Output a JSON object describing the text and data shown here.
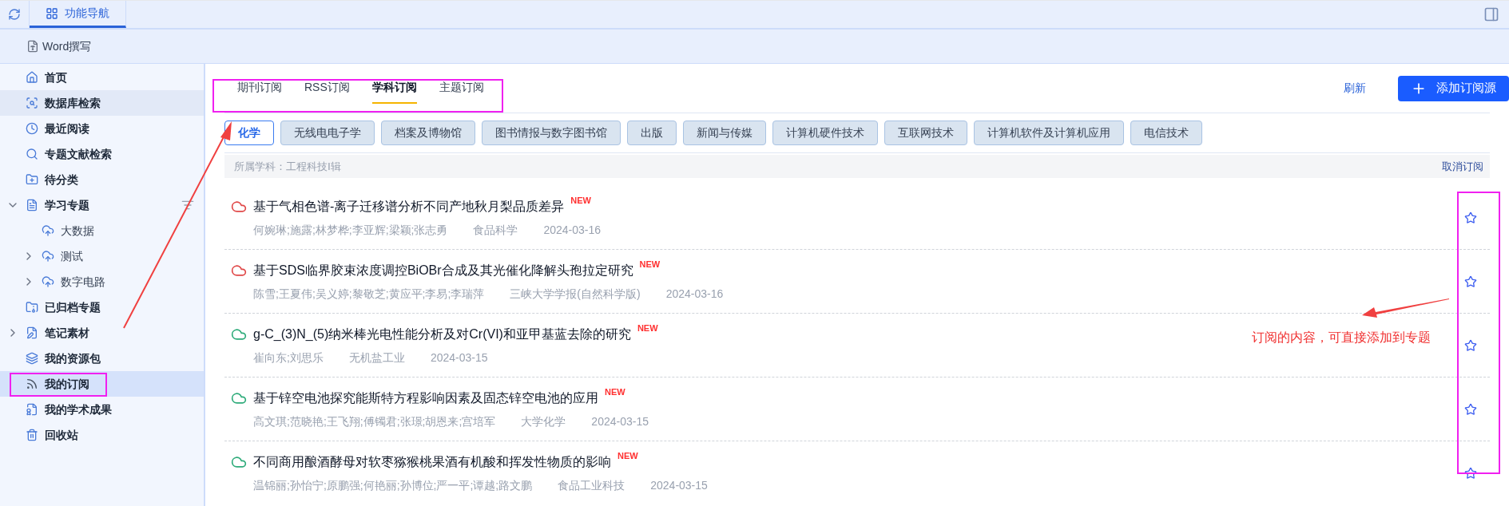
{
  "top_bar": {
    "tabs": [
      {
        "label": "功能导航",
        "selected": true
      }
    ]
  },
  "toolbar": {
    "button": "Word撰写"
  },
  "sidebar": {
    "items": [
      {
        "label": "首页",
        "selected": false,
        "hovered": false
      },
      {
        "label": "数据库检索",
        "selected": false,
        "hovered": true
      },
      {
        "label": "最近阅读",
        "selected": false,
        "hovered": false
      },
      {
        "label": "专题文献检索",
        "selected": false,
        "hovered": false
      },
      {
        "label": "待分类",
        "selected": false,
        "hovered": false
      },
      {
        "label": "学习专题",
        "selected": false,
        "hovered": false,
        "expanded": true,
        "children": [
          {
            "label": "大数据",
            "selected": false,
            "hovered": false
          },
          {
            "label": "测试",
            "selected": false,
            "hovered": false,
            "expanded": false
          },
          {
            "label": "数字电路",
            "selected": false,
            "hovered": false,
            "expanded": false
          }
        ]
      },
      {
        "label": "已归档专题",
        "selected": false,
        "hovered": false
      },
      {
        "label": "笔记素材",
        "selected": false,
        "hovered": false,
        "expanded": false
      },
      {
        "label": "我的资源包",
        "selected": false,
        "hovered": false
      },
      {
        "label": "我的订阅",
        "selected": true,
        "hovered": false
      },
      {
        "label": "我的学术成果",
        "selected": false,
        "hovered": false
      },
      {
        "label": "回收站",
        "selected": false,
        "hovered": false
      }
    ]
  },
  "tabs": [
    {
      "label": "期刊订阅",
      "selected": false
    },
    {
      "label": "RSS订阅",
      "selected": false
    },
    {
      "label": "学科订阅",
      "selected": true
    },
    {
      "label": "主题订阅",
      "selected": false
    }
  ],
  "actions": {
    "refresh": "刷新",
    "add": "添加订阅源"
  },
  "subjects": [
    {
      "label": "化学",
      "selected": true
    },
    {
      "label": "无线电电子学",
      "selected": false
    },
    {
      "label": "档案及博物馆",
      "selected": false
    },
    {
      "label": "图书情报与数字图书馆",
      "selected": false
    },
    {
      "label": "出版",
      "selected": false
    },
    {
      "label": "新闻与传媒",
      "selected": false
    },
    {
      "label": "计算机硬件技术",
      "selected": false
    },
    {
      "label": "互联网技术",
      "selected": false
    },
    {
      "label": "计算机软件及计算机应用",
      "selected": false
    },
    {
      "label": "电信技术",
      "selected": false
    }
  ],
  "category_bar": {
    "label": "所属学科：工程科技Ⅰ辑",
    "unsubscribe": "取消订阅"
  },
  "articles": [
    {
      "kind": "pdf",
      "title": "基于气相色谱-离子迁移谱分析不同产地秋月梨品质差异",
      "badge": "NEW",
      "authors": "何婉琳;施露;林梦桦;李亚辉;梁颖;张志勇",
      "journal": "食品科学",
      "date": "2024-03-16",
      "starred": false
    },
    {
      "kind": "pdf",
      "title": "基于SDS临界胶束浓度调控BiOBr合成及其光催化降解头孢拉定研究",
      "badge": "NEW",
      "authors": "陈雪;王夏伟;吴义婷;黎敬芝;黄应平;李易;李瑞萍",
      "journal": "三峡大学学报(自然科学版)",
      "date": "2024-03-16",
      "starred": false
    },
    {
      "kind": "xml",
      "title": "g-C_(3)N_(5)纳米棒光电性能分析及对Cr(VI)和亚甲基蓝去除的研究",
      "badge": "NEW",
      "authors": "崔向东;刘思乐",
      "journal": "无机盐工业",
      "date": "2024-03-15",
      "starred": false
    },
    {
      "kind": "xml",
      "title": "基于锌空电池探究能斯特方程影响因素及固态锌空电池的应用",
      "badge": "NEW",
      "authors": "高文琪;范晓艳;王飞翔;傅镯君;张璟;胡恩来;宫培军",
      "journal": "大学化学",
      "date": "2024-03-15",
      "starred": false
    },
    {
      "kind": "xml",
      "title": "不同商用酿酒酵母对软枣猕猴桃果酒有机酸和挥发性物质的影响",
      "badge": "NEW",
      "authors": "温锦丽;孙怡宁;原鹏强;何艳丽;孙博位;严一平;谭越;路文鹏",
      "journal": "食品工业科技",
      "date": "2024-03-15",
      "starred": false
    }
  ],
  "annotation": {
    "note": "订阅的内容，可直接添加到专题"
  }
}
